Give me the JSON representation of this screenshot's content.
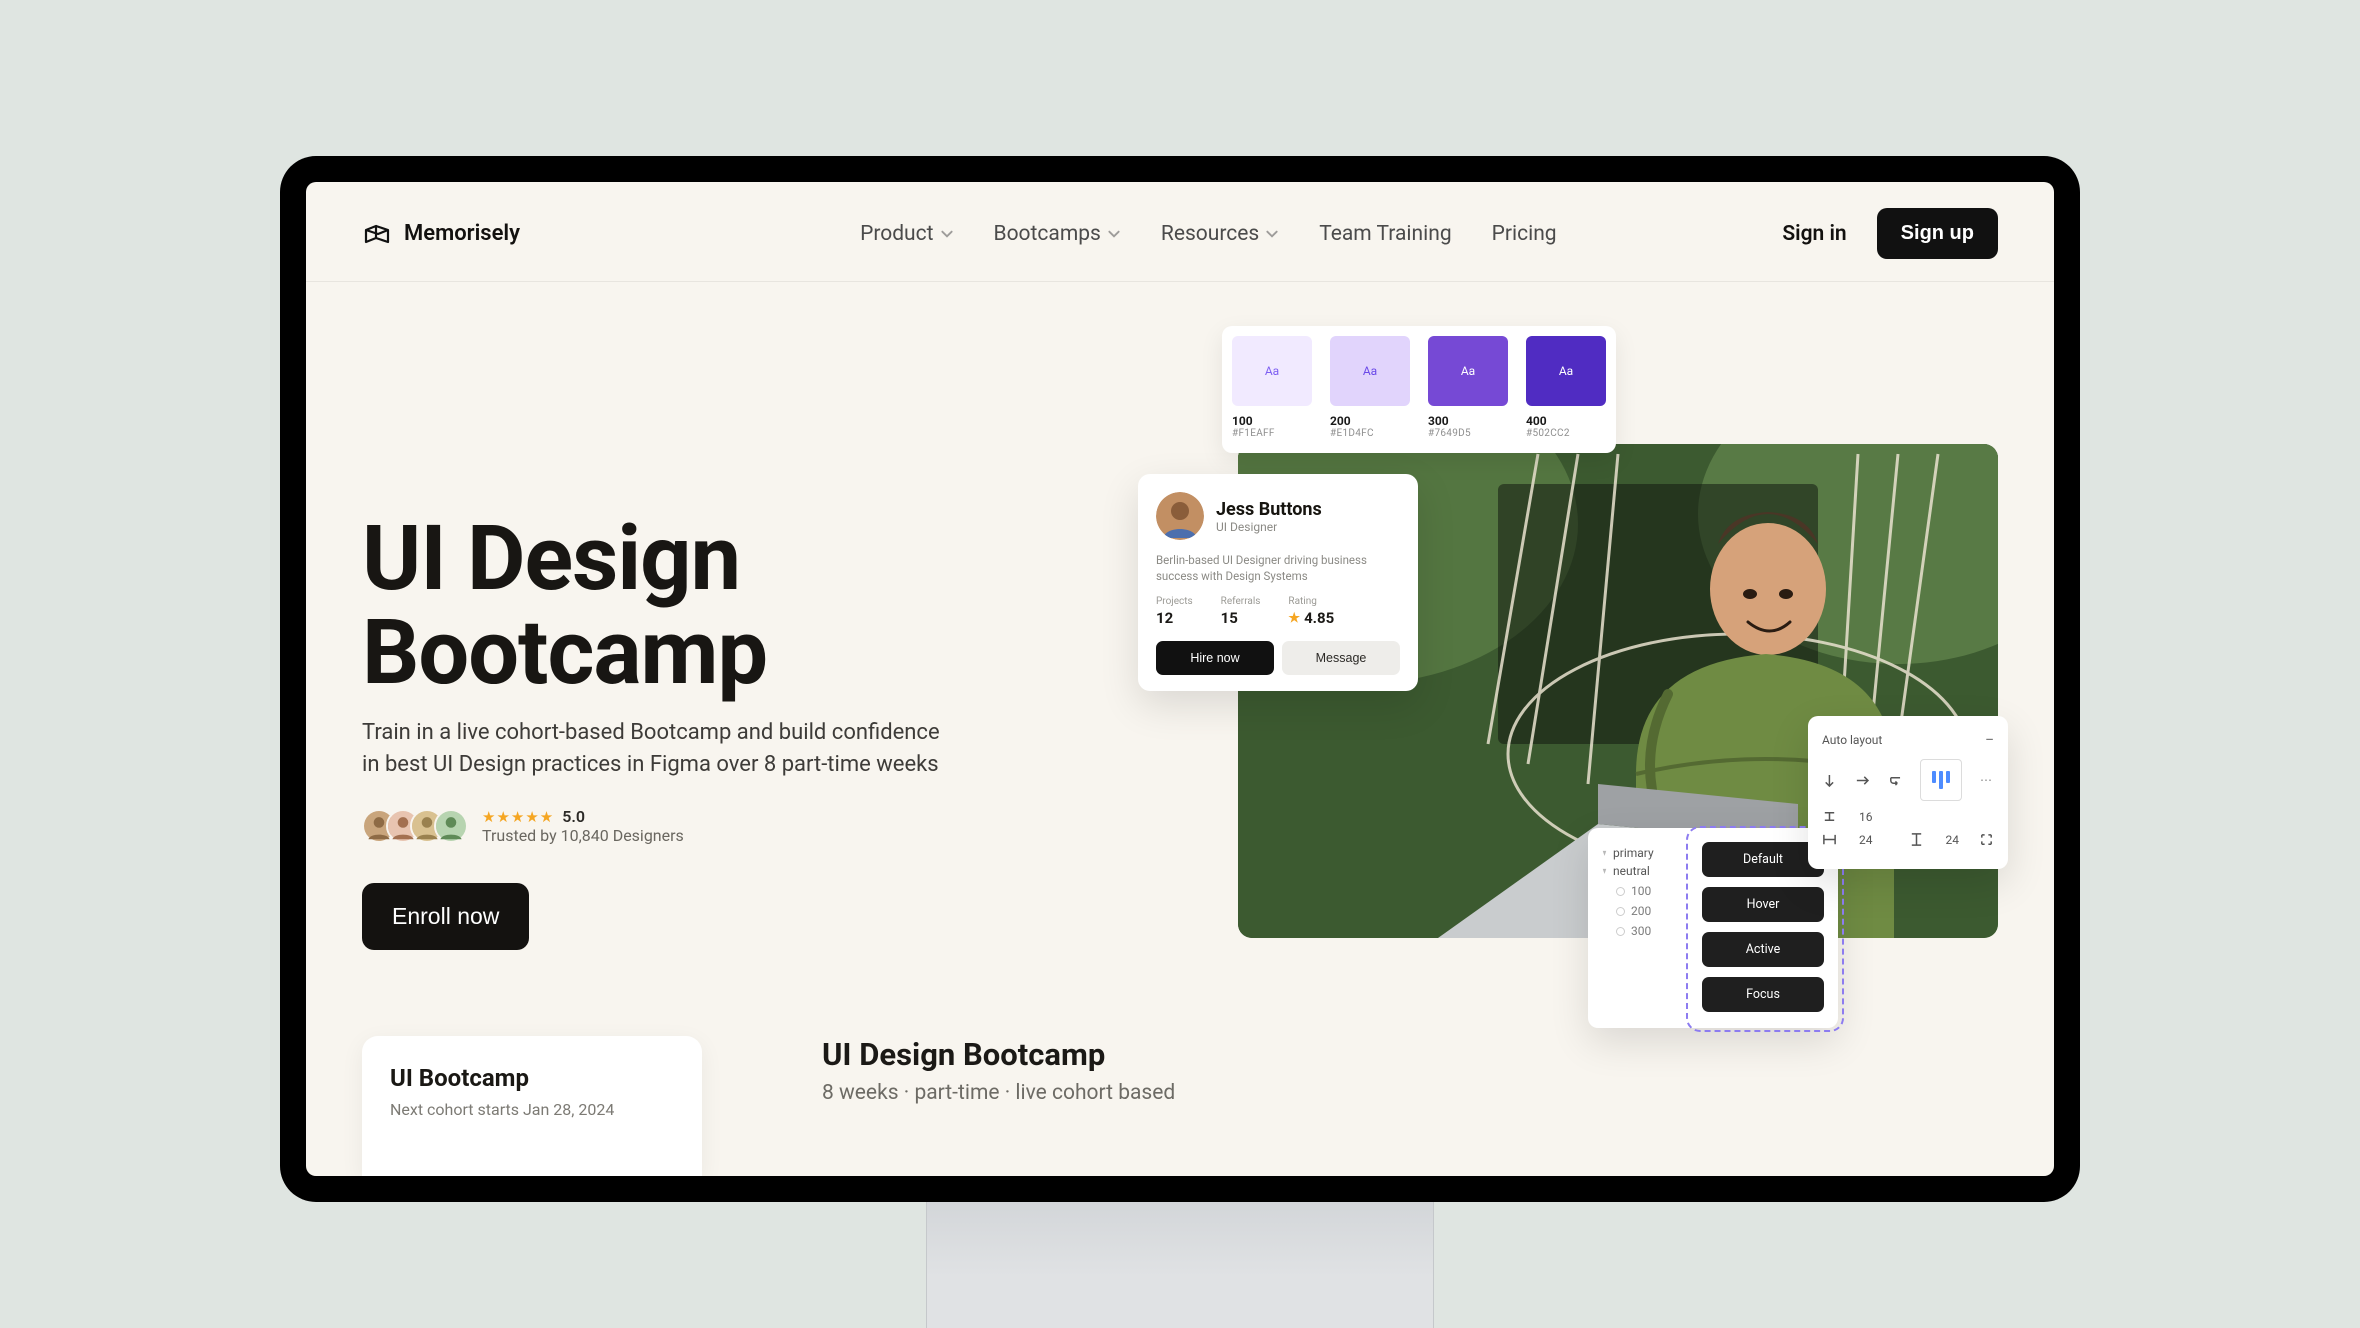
{
  "brand": "Memorisely",
  "nav": {
    "items": [
      {
        "label": "Product",
        "dropdown": true
      },
      {
        "label": "Bootcamps",
        "dropdown": true
      },
      {
        "label": "Resources",
        "dropdown": true
      },
      {
        "label": "Team Training",
        "dropdown": false
      },
      {
        "label": "Pricing",
        "dropdown": false
      }
    ],
    "signin": "Sign in",
    "signup": "Sign up"
  },
  "hero": {
    "title_line1": "UI Design",
    "title_line2": "Bootcamp",
    "subtitle": "Train in a live cohort-based Bootcamp and build confidence in best UI Design practices in Figma over 8 part-time weeks",
    "rating_score": "5.0",
    "trusted_by": "Trusted by 10,840 Designers",
    "cta": "Enroll now"
  },
  "swatches": [
    {
      "num": "100",
      "hex": "#F1EAFF",
      "chip": "#f1eaff",
      "txt": "#7d5ef2"
    },
    {
      "num": "200",
      "hex": "#E1D4FC",
      "chip": "#e1d4fc",
      "txt": "#6a49e8"
    },
    {
      "num": "300",
      "hex": "#7649D5",
      "chip": "#7649d5",
      "txt": "#ffffff"
    },
    {
      "num": "400",
      "hex": "#502CC2",
      "chip": "#502cc2",
      "txt": "#ffffff"
    }
  ],
  "profile": {
    "name": "Jess Buttons",
    "role": "UI Designer",
    "bio": "Berlin-based UI Designer driving business success with Design Systems",
    "stats": {
      "projects_label": "Projects",
      "projects": "12",
      "referrals_label": "Referrals",
      "referrals": "15",
      "rating_label": "Rating",
      "rating": "4.85"
    },
    "hire": "Hire now",
    "message": "Message"
  },
  "tokens": {
    "groups": [
      "primary",
      "neutral"
    ],
    "shades": [
      "100",
      "200",
      "300"
    ],
    "states": [
      "Default",
      "Hover",
      "Active",
      "Focus"
    ]
  },
  "autolayout": {
    "title": "Auto layout",
    "val1": "16",
    "val2": "24",
    "val3": "24"
  },
  "lower": {
    "card_title": "UI Bootcamp",
    "card_sub": "Next cohort starts Jan 28, 2024",
    "title": "UI Design Bootcamp",
    "sub": "8 weeks · part-time · live cohort based"
  }
}
